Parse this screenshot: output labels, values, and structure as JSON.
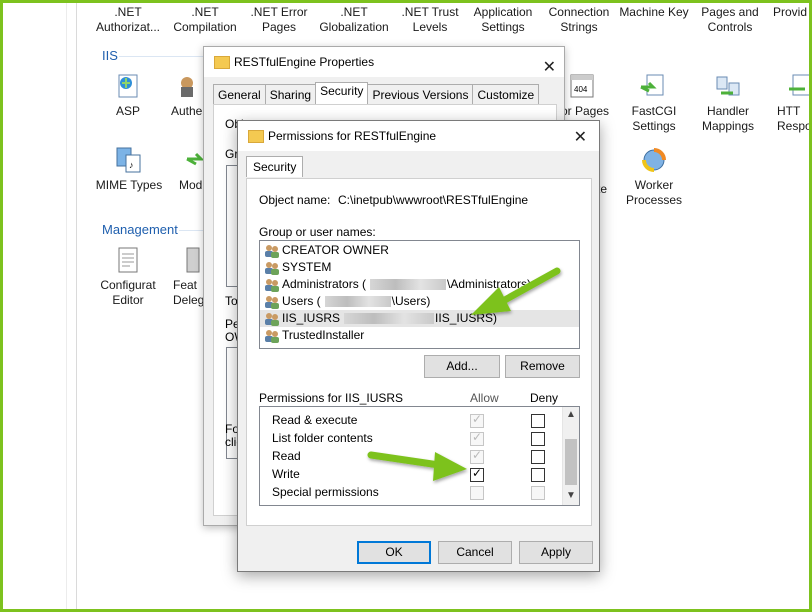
{
  "iis_features": {
    "top_row": [
      {
        "label": ".NET Authorizat...",
        "icon": "net-authorization-icon"
      },
      {
        "label": ".NET Compilation",
        "icon": "net-compilation-icon"
      },
      {
        "label": ".NET Error Pages",
        "icon": "net-error-pages-icon"
      },
      {
        "label": ".NET Globalization",
        "icon": "net-globalization-icon"
      },
      {
        "label": ".NET Trust Levels",
        "icon": "net-trust-levels-icon"
      },
      {
        "label": "Application Settings",
        "icon": "application-settings-icon"
      },
      {
        "label": "Connection Strings",
        "icon": "connection-strings-icon"
      },
      {
        "label": "Machine Key",
        "icon": "machine-key-icon"
      },
      {
        "label": "Pages and Controls",
        "icon": "pages-controls-icon"
      },
      {
        "label": "Provid",
        "icon": "providers-icon"
      }
    ],
    "iis_group": "IIS",
    "iis_items": [
      {
        "label": "ASP",
        "icon": "asp-icon"
      },
      {
        "label": "Authe",
        "icon": "authentication-icon"
      },
      {
        "label": "or Pages",
        "icon": "error-pages-icon"
      },
      {
        "label": "FastCGI Settings",
        "icon": "fastcgi-icon"
      },
      {
        "label": "Handler Mappings",
        "icon": "handler-mappings-icon"
      },
      {
        "label": "HTT Respo",
        "icon": "http-response-icon"
      },
      {
        "label": "MIME Types",
        "icon": "mime-types-icon"
      },
      {
        "label": "Mod",
        "icon": "modules-icon"
      },
      {
        "label": "te",
        "icon": "truncated-icon"
      },
      {
        "label": "Worker Processes",
        "icon": "worker-processes-icon"
      }
    ],
    "management_group": "Management",
    "management_items": [
      {
        "label": "Configurat Editor",
        "icon": "configuration-editor-icon"
      },
      {
        "label": "Feat Deleg",
        "icon": "feature-delegation-icon"
      }
    ]
  },
  "properties_dialog": {
    "title": "RESTfulEngine Properties",
    "tabs": [
      "General",
      "Sharing",
      "Security",
      "Previous Versions",
      "Customize"
    ],
    "selected_tab": "Security",
    "partial_texts": [
      "Obj",
      "Gro",
      "To",
      "Pe",
      "OW",
      "Fo",
      "clic"
    ]
  },
  "permissions_dialog": {
    "title": "Permissions for RESTfulEngine",
    "tab": "Security",
    "object_label": "Object name:",
    "object_value": "C:\\inetpub\\wwwroot\\RESTfulEngine",
    "group_label": "Group or user names:",
    "users": [
      {
        "pre": "CREATOR OWNER",
        "post": "",
        "blurred": false,
        "selected": false
      },
      {
        "pre": "SYSTEM",
        "post": "",
        "blurred": false,
        "selected": false
      },
      {
        "pre": "Administrators (",
        "post": "\\Administrators)",
        "blurred": true,
        "selected": false
      },
      {
        "pre": "Users (",
        "post": "\\Users)",
        "blurred": true,
        "selected": false
      },
      {
        "pre": "IIS_IUSRS",
        "post": "IIS_IUSRS)",
        "blurred": true,
        "selected": true
      },
      {
        "pre": "TrustedInstaller",
        "post": "",
        "blurred": false,
        "selected": false
      }
    ],
    "add_button": "Add...",
    "remove_button": "Remove",
    "permissions_label": "Permissions for IIS_IUSRS",
    "allow_header": "Allow",
    "deny_header": "Deny",
    "permissions": [
      {
        "name": "Read & execute",
        "allow": true,
        "allow_disabled": true,
        "deny": false,
        "deny_disabled": false
      },
      {
        "name": "List folder contents",
        "allow": true,
        "allow_disabled": true,
        "deny": false,
        "deny_disabled": false
      },
      {
        "name": "Read",
        "allow": true,
        "allow_disabled": true,
        "deny": false,
        "deny_disabled": false
      },
      {
        "name": "Write",
        "allow": true,
        "allow_disabled": false,
        "deny": false,
        "deny_disabled": false
      },
      {
        "name": "Special permissions",
        "allow": false,
        "allow_disabled": true,
        "deny": false,
        "deny_disabled": true
      }
    ],
    "ok_button": "OK",
    "cancel_button": "Cancel",
    "apply_button": "Apply"
  },
  "colors": {
    "frame_border": "#7dc21e",
    "arrow": "#7dc21e",
    "group_header": "#1f5fae",
    "selection": "#e5e5e5"
  }
}
